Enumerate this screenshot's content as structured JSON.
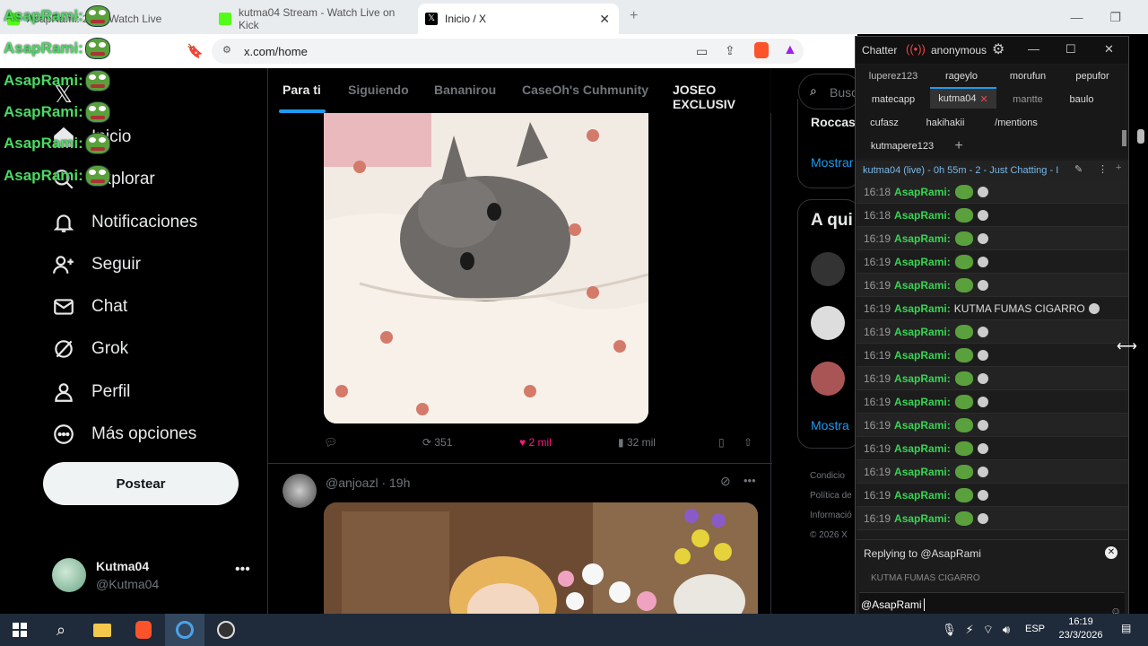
{
  "browser": {
    "tabs": [
      {
        "title": "AsapRami: 2… - Watch Live"
      },
      {
        "title": "kutma04 Stream - Watch Live on Kick"
      },
      {
        "title": "Inicio / X"
      }
    ],
    "new_tab": "+",
    "url": "x.com/home"
  },
  "overlay_chat": {
    "username": "AsapRami:"
  },
  "x_sidebar": {
    "nav": [
      {
        "label": "Inicio",
        "icon": "home-icon"
      },
      {
        "label": "Explorar",
        "icon": "search-icon"
      },
      {
        "label": "Notificaciones",
        "icon": "bell-icon"
      },
      {
        "label": "Seguir",
        "icon": "add-user-icon"
      },
      {
        "label": "Chat",
        "icon": "mail-icon"
      },
      {
        "label": "Grok",
        "icon": "grok-icon"
      },
      {
        "label": "Perfil",
        "icon": "person-icon"
      },
      {
        "label": "Más opciones",
        "icon": "more-icon"
      }
    ],
    "post_button": "Postear",
    "account": {
      "name": "Kutma04",
      "handle": "@Kutma04"
    }
  },
  "timeline": {
    "tabs": [
      "Para ti",
      "Siguiendo",
      "Bananirou",
      "CaseOh's Cuhmunity",
      "JOSEO EXCLUSIV"
    ],
    "post1": {
      "retweets": "351",
      "likes": "2 mil",
      "views": "32 mil"
    },
    "post2": {
      "author": "@anjoazl · 19h"
    }
  },
  "right_column": {
    "search_placeholder": "Busca",
    "trend_label": "Roccas",
    "show_more": "Mostrar",
    "who_to_follow": "A qui",
    "show_more_2": "Mostra",
    "footer": [
      "Condicio",
      "Política de",
      "Informació",
      "© 2026 X"
    ]
  },
  "chatterino": {
    "title": "Chatter",
    "user": "anonymous",
    "tabs_row1": [
      "luperez123",
      "rageylo",
      "morufun",
      "pepufor"
    ],
    "tabs_row2": [
      "matecapp",
      "kutma04",
      "mantte",
      "baulo"
    ],
    "tabs_row3": [
      "cufasz",
      "hakihakii",
      "/mentions"
    ],
    "tabs_row4": [
      "kutmapere123"
    ],
    "channel_header": "kutma04 (live) - 0h 55m - 2 - Just Chatting - I",
    "messages": [
      {
        "time": "16:18",
        "name": "AsapRami:",
        "text": ""
      },
      {
        "time": "16:18",
        "name": "AsapRami:",
        "text": ""
      },
      {
        "time": "16:19",
        "name": "AsapRami:",
        "text": ""
      },
      {
        "time": "16:19",
        "name": "AsapRami:",
        "text": ""
      },
      {
        "time": "16:19",
        "name": "AsapRami:",
        "text": ""
      },
      {
        "time": "16:19",
        "name": "AsapRami:",
        "text": "KUTMA FUMAS CIGARRO"
      },
      {
        "time": "16:19",
        "name": "AsapRami:",
        "text": ""
      },
      {
        "time": "16:19",
        "name": "AsapRami:",
        "text": ""
      },
      {
        "time": "16:19",
        "name": "AsapRami:",
        "text": ""
      },
      {
        "time": "16:19",
        "name": "AsapRami:",
        "text": ""
      },
      {
        "time": "16:19",
        "name": "AsapRami:",
        "text": ""
      },
      {
        "time": "16:19",
        "name": "AsapRami:",
        "text": ""
      },
      {
        "time": "16:19",
        "name": "AsapRami:",
        "text": ""
      },
      {
        "time": "16:19",
        "name": "AsapRami:",
        "text": ""
      },
      {
        "time": "16:19",
        "name": "AsapRami:",
        "text": ""
      }
    ],
    "reply_label": "Replying to @AsapRami",
    "reply_quote": "KUTMA FUMAS CIGARRO",
    "input_value": "@AsapRami"
  },
  "taskbar": {
    "lang": "ESP",
    "time": "16:19",
    "date": "23/3/2026"
  },
  "colors": {
    "accent_blue": "#1d9bf0",
    "like_pink": "#f91880",
    "chat_green": "#39d353"
  }
}
